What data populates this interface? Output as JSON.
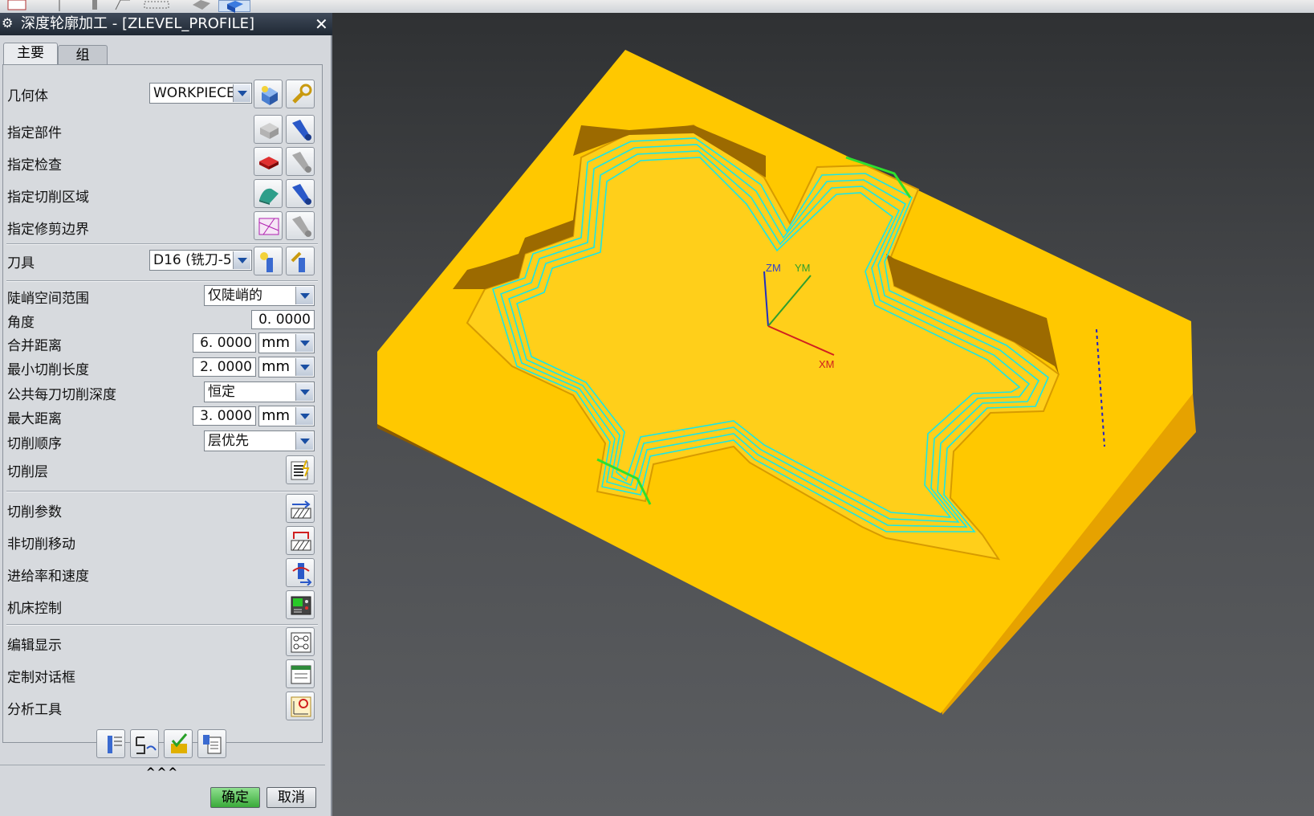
{
  "dialog": {
    "title": "深度轮廓加工 - [ZLEVEL_PROFILE]",
    "close": "✕",
    "tabs": [
      {
        "label": "主要"
      },
      {
        "label": "组"
      }
    ]
  },
  "main": {
    "geometry": {
      "label": "几何体",
      "value": "WORKPIECE"
    },
    "specify_part": {
      "label": "指定部件"
    },
    "specify_check": {
      "label": "指定检查"
    },
    "specify_cut_area": {
      "label": "指定切削区域"
    },
    "specify_trim_boundary": {
      "label": "指定修剪边界"
    },
    "tool": {
      "label": "刀具",
      "value": "D16 (铣刀-5"
    },
    "steep_range": {
      "label": "陡峭空间范围",
      "value": "仅陡峭的"
    },
    "angle": {
      "label": "角度",
      "value": "0. 0000"
    },
    "merge_distance": {
      "label": "合并距离",
      "value": "6. 0000",
      "unit": "mm"
    },
    "min_cut_length": {
      "label": "最小切削长度",
      "value": "2. 0000",
      "unit": "mm"
    },
    "common_depth": {
      "label": "公共每刀切削深度",
      "value": "恒定"
    },
    "max_distance": {
      "label": "最大距离",
      "value": "3. 0000",
      "unit": "mm"
    },
    "cut_order": {
      "label": "切削顺序",
      "value": "层优先"
    },
    "cut_levels": {
      "label": "切削层"
    },
    "cut_params": {
      "label": "切削参数"
    },
    "non_cut_moves": {
      "label": "非切削移动"
    },
    "feeds_speeds": {
      "label": "进给率和速度"
    },
    "machine_control": {
      "label": "机床控制"
    },
    "edit_display": {
      "label": "编辑显示"
    },
    "custom_dialog": {
      "label": "定制对话框"
    },
    "analysis_tools": {
      "label": "分析工具"
    }
  },
  "footer": {
    "collapse": "^^^",
    "ok": "确定",
    "cancel": "取消"
  },
  "viewport": {
    "axes": {
      "x": "XM",
      "y": "YM",
      "z": "ZM"
    },
    "colors": {
      "stock": "#ffc800",
      "side_light": "#e6a200",
      "side_dark": "#8a5a00",
      "toolpath": "#1ae6e6"
    }
  }
}
